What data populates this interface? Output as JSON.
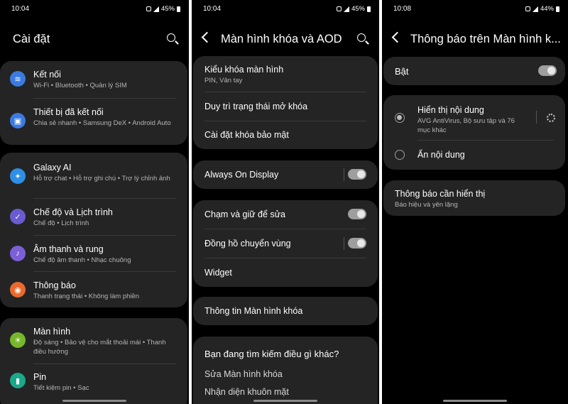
{
  "p1": {
    "time": "10:04",
    "battery": "45%",
    "title": "Cài đặt",
    "items": [
      {
        "title": "Kết nối",
        "sub": "Wi-Fi  •  Bluetooth  •  Quản lý SIM",
        "color": "#3b7be0",
        "icon": "wifi-icon"
      },
      {
        "title": "Thiết bị đã kết nối",
        "sub": "Chia sẻ nhanh  •  Samsung DeX  •  Android Auto",
        "color": "#3b7be0",
        "icon": "devices-icon"
      },
      {
        "title": "Galaxy AI",
        "sub": "Hỗ trợ chat  •  Hỗ trợ ghi chú  •  Trợ lý chỉnh ảnh",
        "color": "#2f8fe6",
        "icon": "sparkle-icon"
      },
      {
        "title": "Chế độ và Lịch trình",
        "sub": "Chế độ  •  Lịch trình",
        "color": "#6a5bd1",
        "icon": "check-circle-icon"
      },
      {
        "title": "Âm thanh và rung",
        "sub": "Chế độ âm thanh  •  Nhạc chuông",
        "color": "#7b5fd6",
        "icon": "speaker-icon"
      },
      {
        "title": "Thông báo",
        "sub": "Thanh trạng thái  •  Không làm phiền",
        "color": "#e86a2e",
        "icon": "notification-icon"
      },
      {
        "title": "Màn hình",
        "sub": "Độ sáng  •  Bảo vệ cho mắt thoải mái  •  Thanh điều hướng",
        "color": "#76b82a",
        "icon": "sun-icon"
      },
      {
        "title": "Pin",
        "sub": "Tiết kiệm pin  •  Sạc",
        "color": "#1aa88a",
        "icon": "battery-icon"
      }
    ]
  },
  "p2": {
    "time": "10:04",
    "battery": "45%",
    "title": "Màn hình khóa và AOD",
    "lock_type": "Kiểu khóa màn hình",
    "lock_type_sub": "PIN, Vân tay",
    "keep_unlocked": "Duy trì trạng thái mở khóa",
    "secure_lock": "Cài đặt khóa bảo mật",
    "aod": "Always On Display",
    "tap_hold": "Chạm và giữ để sửa",
    "roaming_clock": "Đồng hồ chuyển vùng",
    "widget": "Widget",
    "lock_info": "Thông tin Màn hình khóa",
    "looking_for": "Bạn đang tìm kiếm điều gì khác?",
    "edit_lock": "Sửa Màn hình khóa",
    "face_recog": "Nhận diện khuôn mặt"
  },
  "p3": {
    "time": "10:08",
    "battery": "44%",
    "title": "Thông báo trên Màn hình k...",
    "on_label": "Bật",
    "show_content": "Hiển thị nội dung",
    "show_content_sub": "AVG AntiVirus, Bộ sưu tập và 76 mục khác",
    "hide_content": "Ẩn nội dung",
    "notif_to_show": "Thông báo cần hiển thị",
    "notif_to_show_sub": "Báo hiệu và yên lặng"
  },
  "status_icons": [
    "alarm-icon",
    "wifi-icon",
    "signal-icon",
    "battery-icon"
  ]
}
